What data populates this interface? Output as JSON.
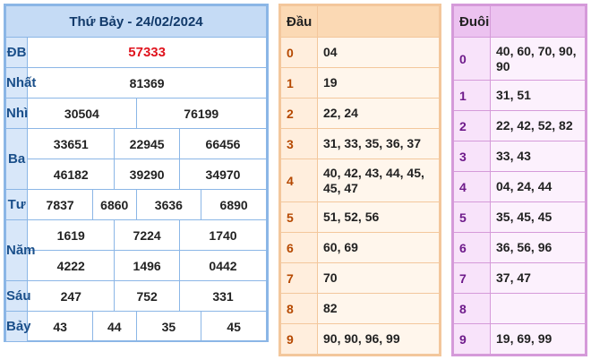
{
  "result": {
    "title": "Thứ Bảy - 24/02/2024",
    "rows": [
      {
        "label": "ĐB",
        "numbers": [
          "57333"
        ]
      },
      {
        "label": "Nhất",
        "numbers": [
          "81369"
        ]
      },
      {
        "label": "Nhì",
        "numbers": [
          "30504",
          "76199"
        ]
      },
      {
        "label": "Ba",
        "numbers": [
          "33651",
          "22945",
          "66456",
          "46182",
          "39290",
          "34970"
        ]
      },
      {
        "label": "Tư",
        "numbers": [
          "7837",
          "6860",
          "3636",
          "6890"
        ]
      },
      {
        "label": "Năm",
        "numbers": [
          "1619",
          "7224",
          "1740",
          "4222",
          "1496",
          "0442"
        ]
      },
      {
        "label": "Sáu",
        "numbers": [
          "247",
          "752",
          "331"
        ]
      },
      {
        "label": "Bảy",
        "numbers": [
          "43",
          "44",
          "35",
          "45"
        ]
      }
    ],
    "colors": {
      "special": "#e0141e",
      "border": "#8bb6e6",
      "header_bg": "#c5dbf5"
    }
  },
  "dau": {
    "header": [
      "Đầu",
      ""
    ],
    "rows": [
      {
        "key": "0",
        "values": "04"
      },
      {
        "key": "1",
        "values": "19"
      },
      {
        "key": "2",
        "values": "22, 24"
      },
      {
        "key": "3",
        "values": "31, 33, 35, 36, 37"
      },
      {
        "key": "4",
        "values": "40, 42, 43, 44, 45, 45, 47"
      },
      {
        "key": "5",
        "values": "51, 52, 56"
      },
      {
        "key": "6",
        "values": "60, 69"
      },
      {
        "key": "7",
        "values": "70"
      },
      {
        "key": "8",
        "values": "82"
      },
      {
        "key": "9",
        "values": "90, 90, 96, 99"
      }
    ]
  },
  "duoi": {
    "header": [
      "Đuôi",
      ""
    ],
    "rows": [
      {
        "key": "0",
        "values": "40, 60, 70, 90, 90"
      },
      {
        "key": "1",
        "values": "31, 51"
      },
      {
        "key": "2",
        "values": "22, 42, 52, 82"
      },
      {
        "key": "3",
        "values": "33, 43"
      },
      {
        "key": "4",
        "values": "04, 24, 44"
      },
      {
        "key": "5",
        "values": "35, 45, 45"
      },
      {
        "key": "6",
        "values": "36, 56, 96"
      },
      {
        "key": "7",
        "values": "37, 47"
      },
      {
        "key": "8",
        "values": ""
      },
      {
        "key": "9",
        "values": "19, 69, 99"
      }
    ]
  }
}
